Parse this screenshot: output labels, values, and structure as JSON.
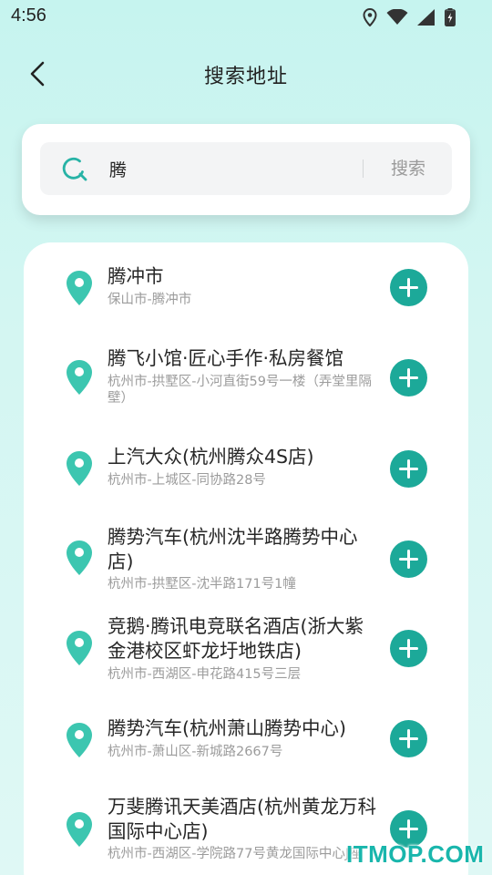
{
  "status_bar": {
    "time": "4:56",
    "icons": [
      "location-icon",
      "wifi-icon",
      "cell-signal-icon",
      "battery-charging-icon"
    ]
  },
  "header": {
    "back_icon": "chevron-left-icon",
    "title": "搜索地址"
  },
  "search": {
    "value": "腾",
    "button_label": "搜索",
    "icon": "search-icon",
    "accent": "#27b3a6"
  },
  "results": [
    {
      "title": "腾冲市",
      "subtitle": "保山市-腾冲市"
    },
    {
      "title": "腾飞小馆·匠心手作·私房餐馆",
      "subtitle": "杭州市-拱墅区-小河直街59号一楼（弄堂里隔壁）"
    },
    {
      "title": "上汽大众(杭州腾众4S店)",
      "subtitle": "杭州市-上城区-同协路28号"
    },
    {
      "title": "腾势汽车(杭州沈半路腾势中心店)",
      "subtitle": "杭州市-拱墅区-沈半路171号1幢"
    },
    {
      "title": "竞鹅·腾讯电竞联名酒店(浙大紫金港校区虾龙圩地铁店)",
      "subtitle": "杭州市-西湖区-申花路415号三层"
    },
    {
      "title": "腾势汽车(杭州萧山腾势中心)",
      "subtitle": "杭州市-萧山区-新城路2667号"
    },
    {
      "title": "万斐腾讯天美酒店(杭州黄龙万科国际中心店)",
      "subtitle": "杭州市-西湖区-学院路77号黄龙国际中心J座"
    }
  ],
  "colors": {
    "background_top": "#c6f4ef",
    "pin": "#3cc6b0",
    "add_button": "#1ca999",
    "watermark": "#19b6ac"
  },
  "watermark": "ITMOP.COM"
}
